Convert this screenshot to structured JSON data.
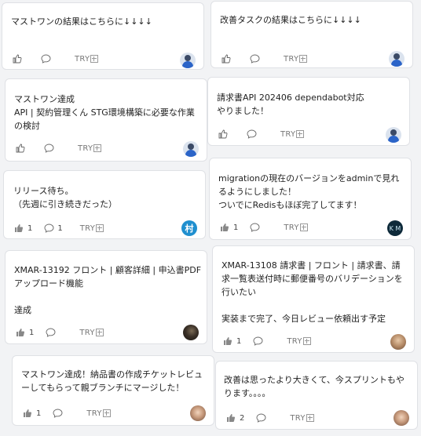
{
  "try_label": "TRY",
  "cards": [
    {
      "text": "マストワンの結果はこちらに↓↓↓↓",
      "likes": "",
      "comments": "",
      "avatar": "person-avatar",
      "avatar_text": ""
    },
    {
      "text": "改善タスクの結果はこちらに↓↓↓↓",
      "likes": "",
      "comments": "",
      "avatar": "person-avatar",
      "avatar_text": ""
    },
    {
      "text": "マストワン達成\nAPI | 契約管理くん STG環境構築に必要な作業の検討",
      "likes": "",
      "comments": "",
      "avatar": "person-avatar",
      "avatar_text": ""
    },
    {
      "text": "請求書API 202406 dependabot対応\nやりました！",
      "likes": "",
      "comments": "",
      "avatar": "person-avatar",
      "avatar_text": ""
    },
    {
      "text": "リリース待ち。\n（先週に引き続きだった）",
      "likes": "1",
      "comments": "1",
      "avatar": "mura-avatar",
      "avatar_text": "村"
    },
    {
      "text": "migrationの現在のバージョンをadminで見れるようにしました！\nついでにRedisもほぼ完了してます！",
      "likes": "1",
      "comments": "",
      "avatar": "km-avatar",
      "avatar_text": "K M"
    },
    {
      "text": "XMAR-13192 フロント | 顧客詳細 | 申込書PDFアップロード機能\n\n達成",
      "likes": "1",
      "comments": "",
      "avatar": "photo-avatar",
      "avatar_text": ""
    },
    {
      "text": "XMAR-13108 請求書 | フロント | 請求書、請求一覧表送付時に郵便番号のバリデーションを行いたい\n\n実装まで完了、今日レビュー依頼出す予定",
      "likes": "1",
      "comments": "",
      "avatar": "photo-avatar",
      "avatar_text": ""
    },
    {
      "text": "マストワン達成！納品書の作成チケットレビューしてもらって親ブランチにマージした！",
      "likes": "1",
      "comments": "",
      "avatar": "photo-avatar",
      "avatar_text": ""
    },
    {
      "text": "改善は思ったより大きくて、今スプリントもやります。。。。",
      "likes": "2",
      "comments": "",
      "avatar": "photo-avatar",
      "avatar_text": ""
    }
  ]
}
